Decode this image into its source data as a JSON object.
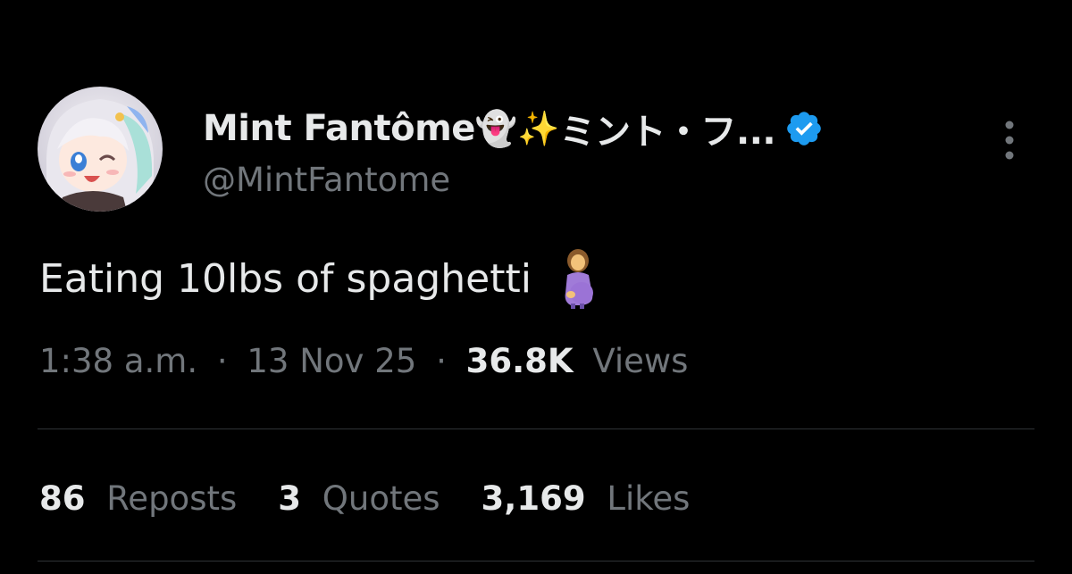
{
  "tweet": {
    "author": {
      "display_name": "Mint Fantôme",
      "name_emojis": "👻✨",
      "name_suffix": "ミント・フ...",
      "handle": "@MintFantome",
      "verified": true,
      "verified_color": "#1d9bf0"
    },
    "text": "Eating 10lbs of spaghetti",
    "text_emoji": "pregnant-woman-emoji",
    "meta": {
      "time": "1:38 a.m.",
      "separator": "·",
      "date": "13 Nov 25",
      "views_count": "36.8K",
      "views_label": "Views"
    },
    "stats": {
      "reposts_count": "86",
      "reposts_label": "Reposts",
      "quotes_count": "3",
      "quotes_label": "Quotes",
      "likes_count": "3,169",
      "likes_label": "Likes"
    },
    "icons": {
      "more": "more-vertical-icon",
      "verified": "verified-badge-icon"
    }
  }
}
